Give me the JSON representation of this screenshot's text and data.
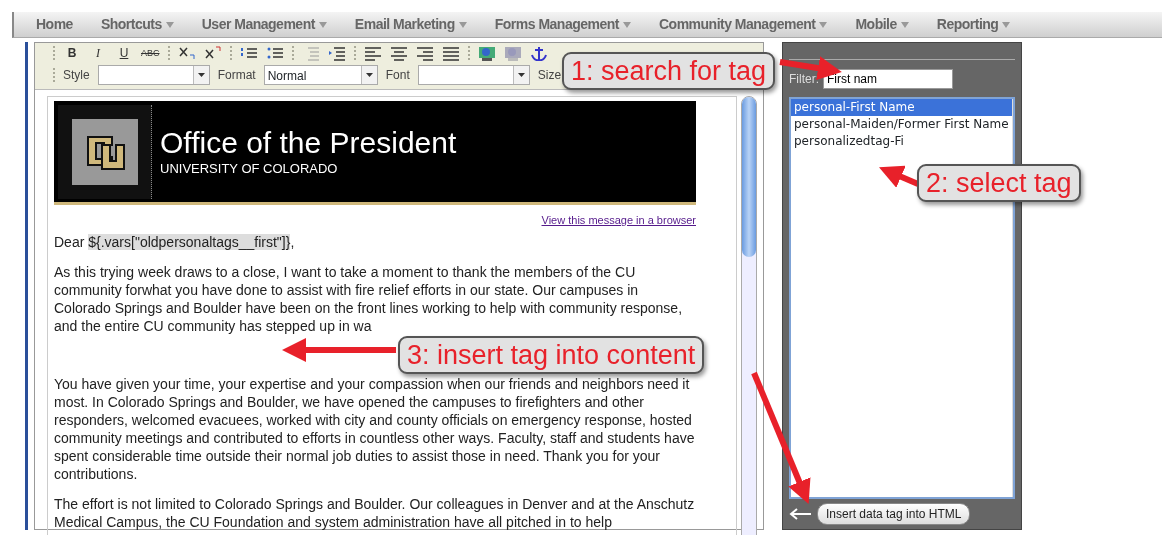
{
  "menu": [
    {
      "label": "Home",
      "dropdown": false
    },
    {
      "label": "Shortcuts",
      "dropdown": true
    },
    {
      "label": "User Management",
      "dropdown": true
    },
    {
      "label": "Email Marketing",
      "dropdown": true
    },
    {
      "label": "Forms Management",
      "dropdown": true
    },
    {
      "label": "Community Management",
      "dropdown": true
    },
    {
      "label": "Mobile",
      "dropdown": true
    },
    {
      "label": "Reporting",
      "dropdown": true
    }
  ],
  "toolbar": {
    "text_buttons": [
      {
        "label": "B",
        "kind": "bold"
      },
      {
        "label": "I",
        "kind": "italic"
      },
      {
        "label": "U",
        "kind": "underline"
      },
      {
        "label": "ABC",
        "kind": "strike"
      }
    ],
    "selects": [
      {
        "label": "Style"
      },
      {
        "label": "Format",
        "value": "Normal"
      },
      {
        "label": "Font"
      }
    ],
    "size_label": "Size"
  },
  "email": {
    "title": "Office of the President",
    "subtitle": "UNIVERSITY OF COLORADO",
    "view_link": "View this message in a browser",
    "greeting": "Dear",
    "merge_tag": "${.vars[\"oldpersonaltags__first\"]}",
    "greeting_end": ",",
    "paragraphs": [
      "As this trying week draws to a close, I want to take a moment to thank the members of the CU community forwhat you have done to assist with fire relief efforts in our state. Our campuses in Colorado Springs and Boulder have been on the front lines working to help with community response, and the entire CU community has stepped up in wa",
      "You have given your time, your expertise and your compassion when our friends and neighbors need it most. In Colorado Springs and Boulder, we have opened the campuses to firefighters and other responders, welcomed evacuees, worked with city and county officials on emergency response, hosted community meetings and contributed to efforts in countless other ways. Faculty, staff and students have spent considerable time outside their normal job duties to assist those in need. Thank you for your contributions.",
      "The effort is not limited to Colorado Springs and Boulder. Our colleagues in Denver and at the Anschutz Medical Campus, the CU Foundation and system administration have all pitched in to help"
    ]
  },
  "tag_panel": {
    "filter_label": "Filter:",
    "filter_value": "First nam",
    "tags": [
      {
        "label": "personal-First Name",
        "selected": true
      },
      {
        "label": "personal-Maiden/Former First Name",
        "selected": false
      },
      {
        "label": "personalizedtag-Fi",
        "selected": false
      }
    ],
    "insert_button": "Insert data tag into HTML"
  },
  "callouts": [
    {
      "text": "1: search for tag"
    },
    {
      "text": "2: select tag"
    },
    {
      "text": "3: insert tag into content"
    }
  ]
}
